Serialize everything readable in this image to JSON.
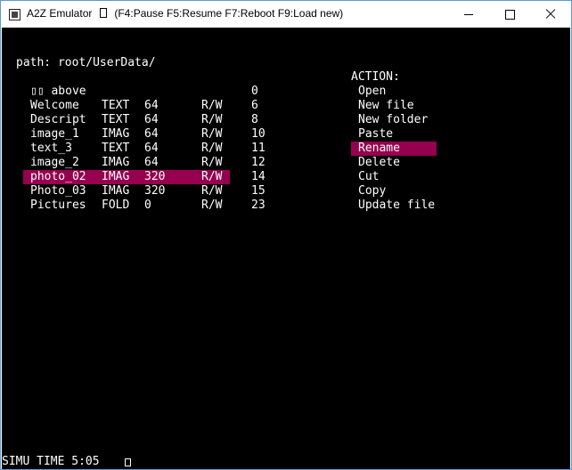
{
  "window": {
    "title": "A2Z Emulator",
    "shortcuts": "(F4:Pause F5:Resume F7:Reboot F9:Load new)"
  },
  "screen": {
    "path": "path: root/UserData/",
    "action_header": "ACTION:",
    "files": [
      {
        "name": "▯▯ above",
        "type": "",
        "size": "",
        "perm": "",
        "num": "0"
      },
      {
        "name": "Welcome",
        "type": "TEXT",
        "size": "64",
        "perm": "R/W",
        "num": "6"
      },
      {
        "name": "Descript",
        "type": "TEXT",
        "size": "64",
        "perm": "R/W",
        "num": "8"
      },
      {
        "name": "image_1",
        "type": "IMAG",
        "size": "64",
        "perm": "R/W",
        "num": "10"
      },
      {
        "name": "text_3",
        "type": "TEXT",
        "size": "64",
        "perm": "R/W",
        "num": "11"
      },
      {
        "name": "image_2",
        "type": "IMAG",
        "size": "64",
        "perm": "R/W",
        "num": "12"
      },
      {
        "name": "photo_02",
        "type": "IMAG",
        "size": "320",
        "perm": "R/W",
        "num": "14"
      },
      {
        "name": "Photo_03",
        "type": "IMAG",
        "size": "320",
        "perm": "R/W",
        "num": "15"
      },
      {
        "name": "Pictures",
        "type": "FOLD",
        "size": "0",
        "perm": "R/W",
        "num": "23"
      }
    ],
    "selected_file": 6,
    "actions": [
      "Open",
      "New file",
      "New folder",
      "Paste",
      "Rename",
      "Delete",
      "Cut",
      "Copy",
      "Update file"
    ],
    "selected_action": 4,
    "status": "SIMU TIME 5:05"
  },
  "colors": {
    "highlight": "#96004f",
    "screen_bg": "#000000",
    "text": "#ffffff"
  }
}
